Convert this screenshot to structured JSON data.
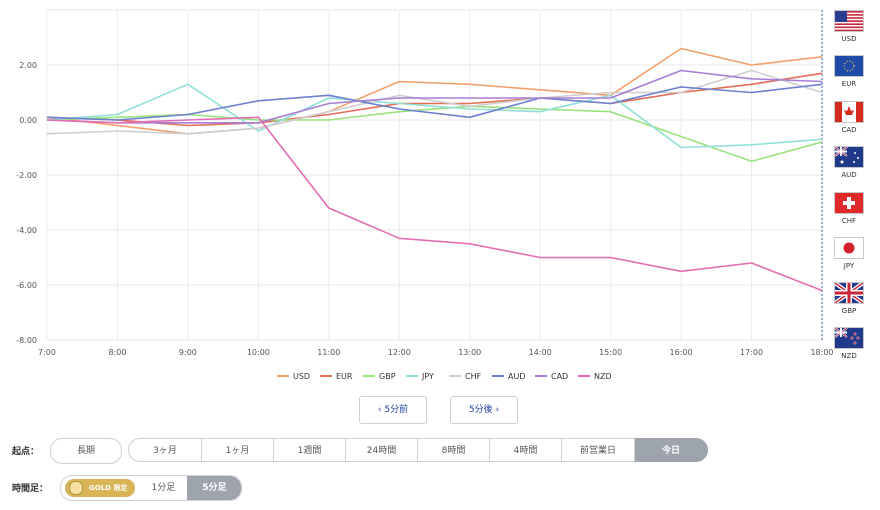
{
  "chart_data": {
    "type": "line",
    "x": [
      "7:00",
      "8:00",
      "9:00",
      "10:00",
      "11:00",
      "12:00",
      "13:00",
      "14:00",
      "15:00",
      "16:00",
      "17:00",
      "18:00"
    ],
    "ylim": [
      -8,
      4
    ],
    "yticks": [
      "2.00",
      "0.00",
      "-2.00",
      "-4.00",
      "-6.00",
      "-8.00"
    ],
    "grid": true,
    "legend_position": "bottom",
    "series": [
      {
        "name": "USD",
        "color": "#f2a06a",
        "values": [
          0.1,
          -0.2,
          -0.5,
          -0.3,
          0.3,
          1.4,
          1.3,
          1.1,
          0.9,
          2.6,
          2.0,
          2.3
        ]
      },
      {
        "name": "EUR",
        "color": "#e36d55",
        "values": [
          0.1,
          0.0,
          -0.2,
          -0.1,
          0.2,
          0.6,
          0.6,
          0.8,
          0.6,
          1.0,
          1.3,
          1.7
        ]
      },
      {
        "name": "GBP",
        "color": "#98e37c",
        "values": [
          0.0,
          0.1,
          0.2,
          0.0,
          0.0,
          0.3,
          0.5,
          0.4,
          0.3,
          -0.6,
          -1.5,
          -0.8
        ]
      },
      {
        "name": "JPY",
        "color": "#90e0d8",
        "values": [
          0.0,
          0.2,
          1.3,
          -0.4,
          0.8,
          0.6,
          0.4,
          0.3,
          0.9,
          -1.0,
          -0.9,
          -0.7
        ]
      },
      {
        "name": "CHF",
        "color": "#cfcfcf",
        "values": [
          -0.5,
          -0.4,
          -0.5,
          -0.3,
          0.3,
          0.9,
          0.5,
          0.8,
          1.0,
          1.0,
          1.8,
          1.0
        ]
      },
      {
        "name": "AUD",
        "color": "#6c80d0",
        "values": [
          0.1,
          0.0,
          0.2,
          0.7,
          0.9,
          0.4,
          0.1,
          0.8,
          0.6,
          1.2,
          1.0,
          1.3
        ]
      },
      {
        "name": "CAD",
        "color": "#a87fd6",
        "values": [
          0.0,
          -0.1,
          -0.1,
          -0.1,
          0.6,
          0.8,
          0.8,
          0.8,
          0.8,
          1.8,
          1.5,
          1.4
        ]
      },
      {
        "name": "NZD",
        "color": "#e36db2",
        "values": [
          0.0,
          -0.1,
          0.0,
          0.1,
          -3.2,
          -4.3,
          -4.5,
          -5.0,
          -5.0,
          -5.5,
          -5.2,
          -6.2
        ]
      }
    ]
  },
  "currency_list": [
    {
      "code": "USD",
      "icon": "us-flag-icon"
    },
    {
      "code": "EUR",
      "icon": "eu-flag-icon"
    },
    {
      "code": "CAD",
      "icon": "ca-flag-icon"
    },
    {
      "code": "AUD",
      "icon": "au-flag-icon"
    },
    {
      "code": "CHF",
      "icon": "ch-flag-icon"
    },
    {
      "code": "JPY",
      "icon": "jp-flag-icon"
    },
    {
      "code": "GBP",
      "icon": "gb-flag-icon"
    },
    {
      "code": "NZD",
      "icon": "nz-flag-icon"
    }
  ],
  "nav": {
    "prev": "5分前",
    "next": "5分後"
  },
  "start_label": "起点：",
  "long_label": "長期",
  "periods": [
    "3ヶ月",
    "1ヶ月",
    "1週間",
    "24時間",
    "8時間",
    "4時間",
    "前営業日",
    "今日"
  ],
  "active_period": "今日",
  "timeframe_label": "時間足：",
  "gold_badge": "GOLD 限定",
  "timeframes": [
    "1分足",
    "5分足"
  ],
  "active_timeframe": "5分足"
}
